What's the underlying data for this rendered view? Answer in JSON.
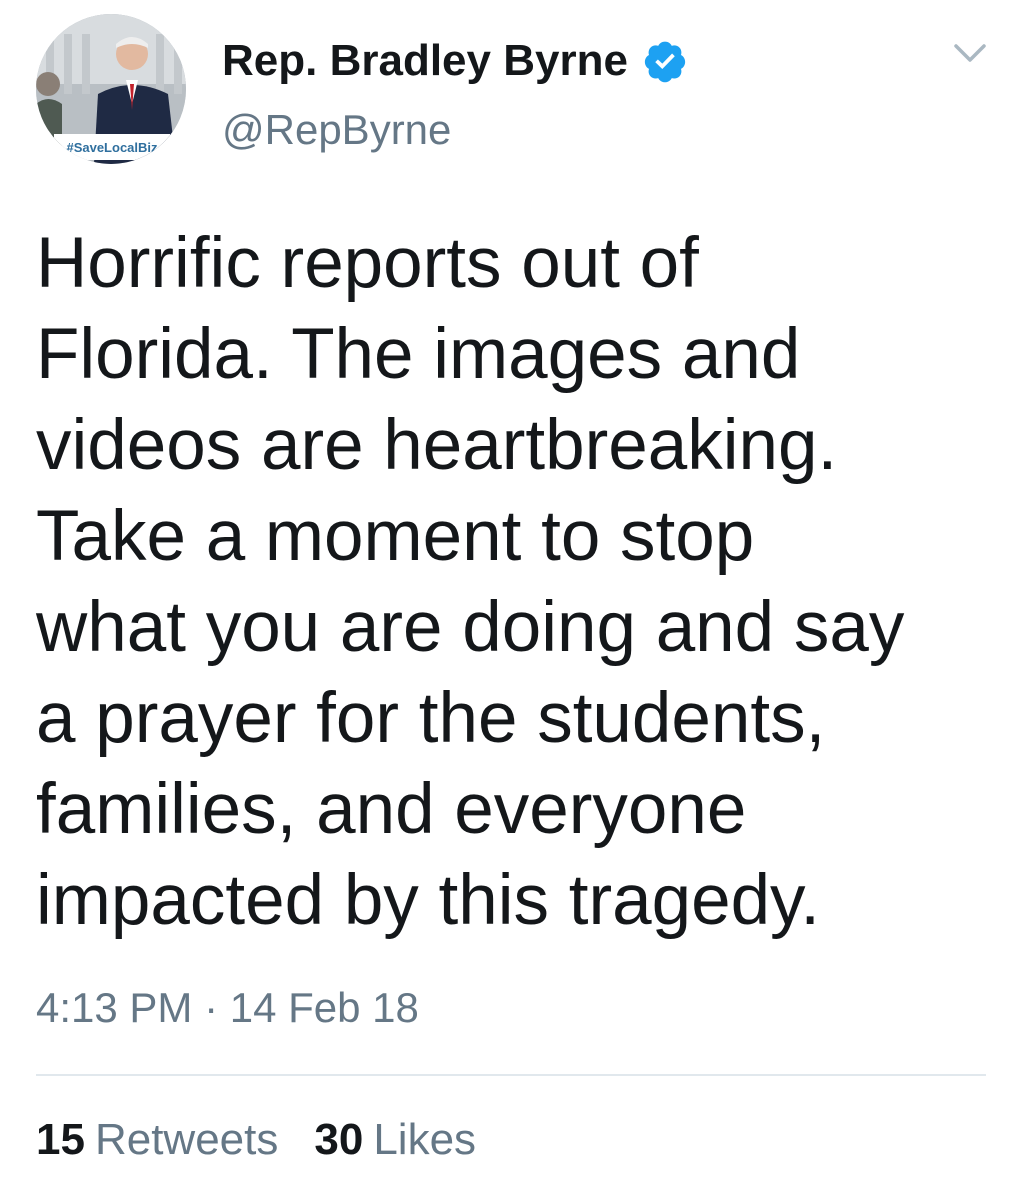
{
  "tweet": {
    "author": {
      "display_name": "Rep. Bradley Byrne",
      "handle": "@RepByrne",
      "verified": true,
      "avatar_icon": "profile-photo",
      "avatar_sign_text": "#SaveLocalBiz"
    },
    "text_lines": [
      "Horrific reports out of",
      "Florida. The images and",
      "videos are heartbreaking.",
      "Take a moment to stop",
      "what you are doing and say",
      "a prayer for the students,",
      "families, and everyone",
      "impacted by this tragedy."
    ],
    "timestamp": "4:13 PM · 14 Feb 18",
    "stats": {
      "retweets_count": "15",
      "retweets_label": "Retweets",
      "likes_count": "30",
      "likes_label": "Likes"
    }
  },
  "icons": {
    "verified": "verified-badge-icon",
    "menu": "chevron-down-icon"
  },
  "colors": {
    "text": "#14171a",
    "secondary": "#657786",
    "verified_blue": "#1da1f2",
    "divider": "#e1e8ed"
  }
}
